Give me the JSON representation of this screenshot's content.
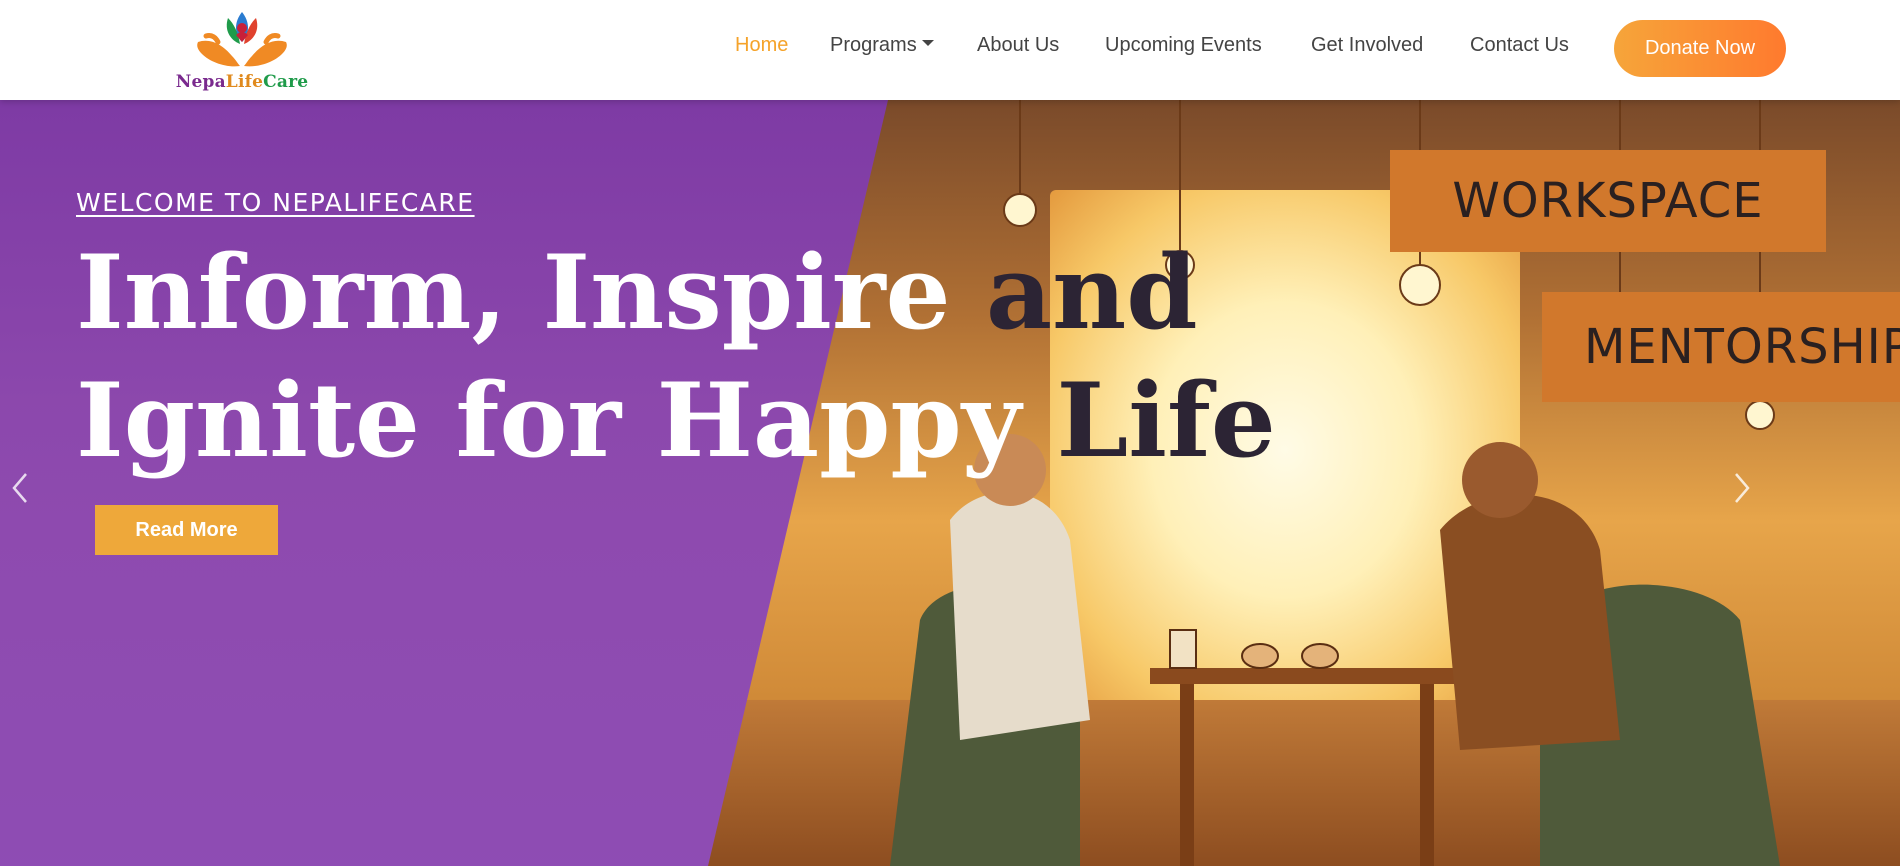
{
  "brand": {
    "logo_part1": "Nepa",
    "logo_part2": "Life",
    "logo_part3": "Care"
  },
  "nav": {
    "items": [
      {
        "label": "Home",
        "active": true
      },
      {
        "label": "Programs",
        "dropdown": true
      },
      {
        "label": "About Us"
      },
      {
        "label": "Upcoming Events"
      },
      {
        "label": "Get Involved"
      },
      {
        "label": "Contact Us"
      }
    ],
    "cta": "Donate Now"
  },
  "hero": {
    "eyebrow": "WELCOME TO NEPALIFECARE",
    "headline_line1_a": "Inform, Inspire ",
    "headline_line1_b": "and",
    "headline_line2_a": "Ignite for Happy ",
    "headline_line2_b": "Life",
    "button": "Read More",
    "sign_1": "WORKSPACE",
    "sign_2": "MENTORSHIP"
  },
  "colors": {
    "accent": "#f5a32a",
    "purple": "#8a46b0",
    "dark_text": "#2c2434",
    "button": "#eea83a"
  },
  "icons": [
    "logo-lotus-hands-icon",
    "chevron-left-icon",
    "chevron-right-icon",
    "caret-down-icon"
  ]
}
